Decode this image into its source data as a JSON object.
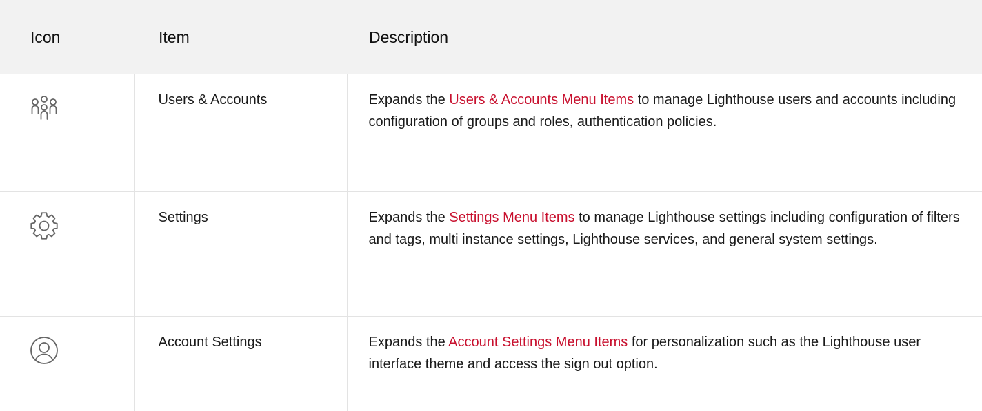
{
  "table": {
    "headers": {
      "icon": "Icon",
      "item": "Item",
      "description": "Description"
    },
    "rows": [
      {
        "icon": "users-group-icon",
        "item": "Users & Accounts",
        "desc_before": "Expands the ",
        "desc_link": "Users & Accounts Menu Items",
        "desc_after": " to manage Lighthouse users and accounts including configuration of groups and roles, authentication policies."
      },
      {
        "icon": "gear-icon",
        "item": "Settings",
        "desc_before": "Expands the ",
        "desc_link": "Settings Menu Items",
        "desc_after": " to manage Lighthouse settings including configuration of filters and tags, multi instance settings, Light­house services, and general system settings."
      },
      {
        "icon": "user-circle-icon",
        "item": "Account Settings",
        "desc_before": "Expands the ",
        "desc_link": "Account Settings Menu Items",
        "desc_after": " for personalization such as the Lighthouse user interface theme and access the sign out option."
      }
    ]
  },
  "colors": {
    "header_bg": "#f2f2f2",
    "link": "#c8102e",
    "border": "#e3e3e3",
    "icon": "#666666"
  }
}
